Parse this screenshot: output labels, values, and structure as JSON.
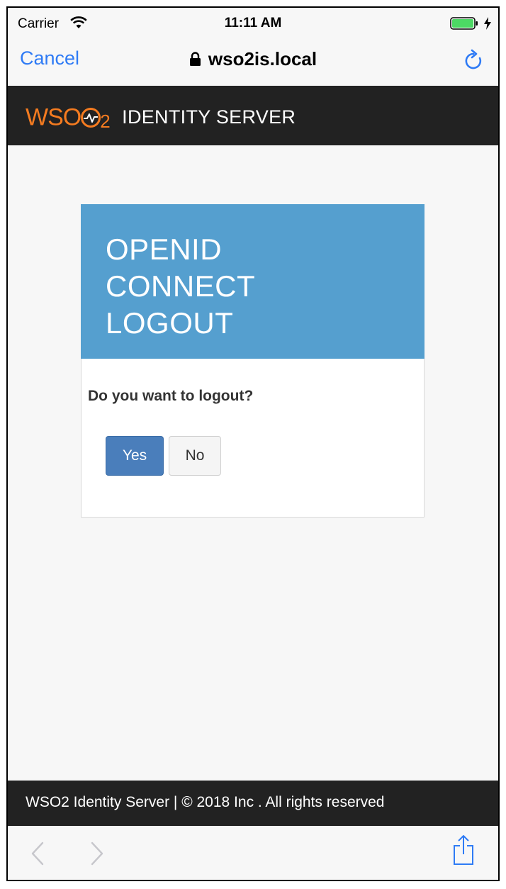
{
  "status_bar": {
    "carrier": "Carrier",
    "time": "11:11 AM",
    "icons": [
      "wifi-icon",
      "battery-icon",
      "charging-bolt-icon"
    ]
  },
  "browser_bar": {
    "cancel_label": "Cancel",
    "url": "wso2is.local",
    "icons": [
      "lock-icon",
      "reload-icon"
    ],
    "accent_color": "#2f7bf5"
  },
  "app_header": {
    "logo_text": "WSO",
    "logo_subscript": "2",
    "product_name": "IDENTITY SERVER",
    "background": "#222222",
    "brand_color": "#f47b20"
  },
  "card": {
    "title": "OPENID CONNECT LOGOUT",
    "header_color": "#559fcf",
    "question": "Do you want to logout?",
    "yes_label": "Yes",
    "no_label": "No",
    "primary_color": "#4a7ebb"
  },
  "footer": {
    "text": "WSO2 Identity Server | © 2018 Inc . All rights reserved"
  },
  "toolbar": {
    "icons": [
      "back-arrow-icon",
      "forward-arrow-icon",
      "share-icon"
    ]
  }
}
